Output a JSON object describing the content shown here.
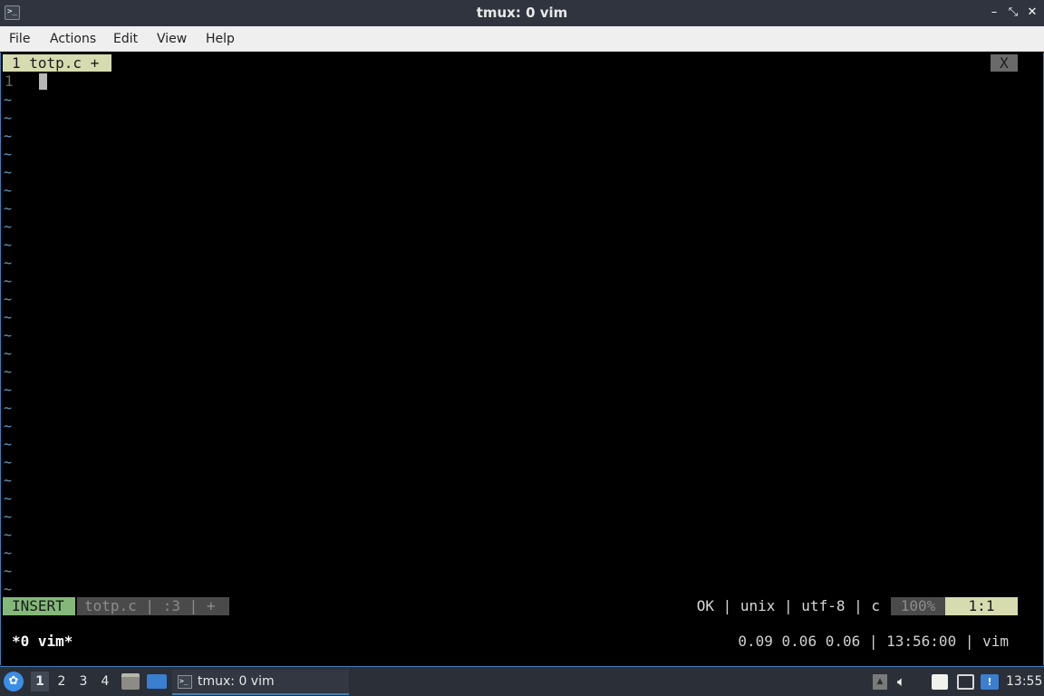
{
  "window": {
    "title": "tmux: 0 vim",
    "app_icon_glyph": ">_",
    "minimize_glyph": "–",
    "maximize_glyph": "⤡",
    "close_glyph": "✕"
  },
  "menubar": {
    "items": [
      "File",
      "Actions",
      "Edit",
      "View",
      "Help"
    ]
  },
  "vim": {
    "tab_label": "1 totp.c +",
    "tab_close": "X",
    "line_numbers": [
      "1"
    ],
    "empty_line_marker": "~",
    "status": {
      "mode": "INSERT",
      "file": "totp.c | :3 | +",
      "info": "OK | unix | utf-8 | c",
      "percent": "100%",
      "position": "1:1"
    }
  },
  "tmux": {
    "window_list": "*0 vim*",
    "status_right": "0.09 0.06 0.06 | 13:56:00 | vim"
  },
  "taskbar": {
    "start_icon": "start-menu-icon",
    "workspaces": [
      "1",
      "2",
      "3",
      "4"
    ],
    "active_workspace": "1",
    "task_label": "tmux: 0 vim",
    "clock": "13:55"
  },
  "colors": {
    "titlebar": "#2f343f",
    "accent": "#3f7fb8",
    "insert_mode": "#84b87a",
    "tab_active": "#d7dcb0",
    "tilde": "#6a9ec0"
  }
}
